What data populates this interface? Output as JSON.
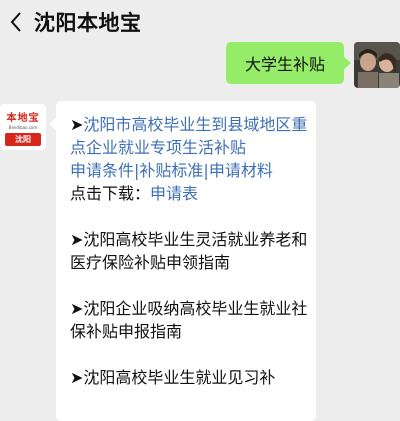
{
  "header": {
    "back_icon": "chevron-left-icon",
    "title": "沈阳本地宝"
  },
  "outgoing": {
    "text": "大学生补贴"
  },
  "incoming": {
    "logo": {
      "brand": "本地宝",
      "url": "Bendibao.com",
      "city": "沈阳"
    },
    "items": [
      {
        "arrow": "➤",
        "title": "沈阳市高校毕业生到县域地区重点企业就业专项生活补贴",
        "links": [
          "申请条件",
          "补贴标准",
          "申请材料"
        ],
        "download_label": "点击下载：",
        "download_link": "申请表"
      },
      {
        "arrow": "➤",
        "title": "沈阳高校毕业生灵活就业养老和医疗保险补贴申领指南"
      },
      {
        "arrow": "➤",
        "title": "沈阳企业吸纳高校毕业生就业社保补贴申报指南"
      },
      {
        "arrow": "➤",
        "title": "沈阳高校毕业生就业见习补"
      }
    ]
  },
  "colors": {
    "background": "#ededed",
    "outgoing_bubble": "#95ec69",
    "link": "#3f6fb5",
    "logo_red": "#d7261b"
  }
}
